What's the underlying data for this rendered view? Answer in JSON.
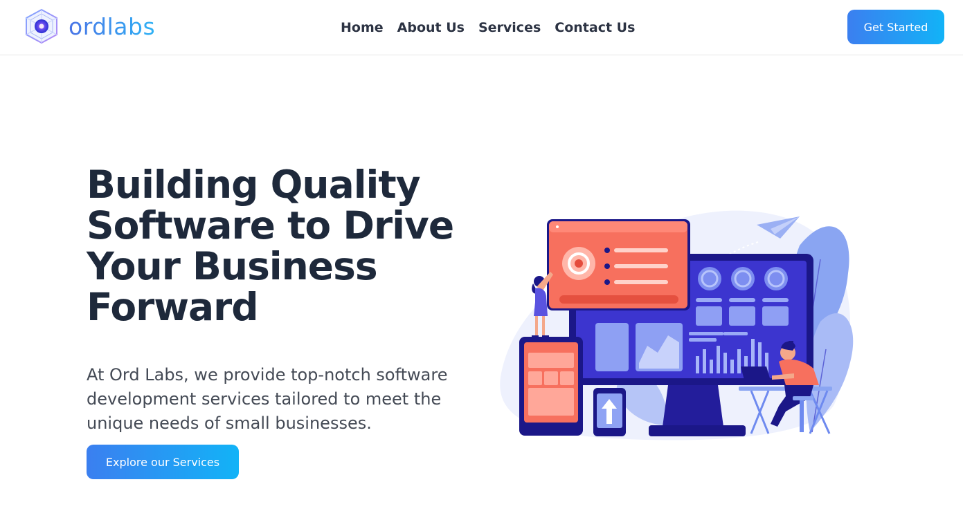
{
  "brand": {
    "name": "ordlabs",
    "logo_icon": "hexagon-cube-logo-icon"
  },
  "nav": {
    "items": [
      {
        "label": "Home"
      },
      {
        "label": "About Us"
      },
      {
        "label": "Services"
      },
      {
        "label": "Contact Us"
      }
    ],
    "cta_label": "Get Started"
  },
  "hero": {
    "title": "Building Quality Software to Drive Your Business Forward",
    "description": "At Ord Labs, we provide top-notch software development services tailored to meet the unique needs of small businesses.",
    "cta_label": "Explore our Services",
    "illustration": "software-development-team-illustration"
  },
  "colors": {
    "brand_blue": "#3b7ff0",
    "brand_cyan": "#12b3f7",
    "heading": "#1e293b",
    "illustration_indigo": "#3f33c9",
    "illustration_coral": "#f46d5b"
  }
}
